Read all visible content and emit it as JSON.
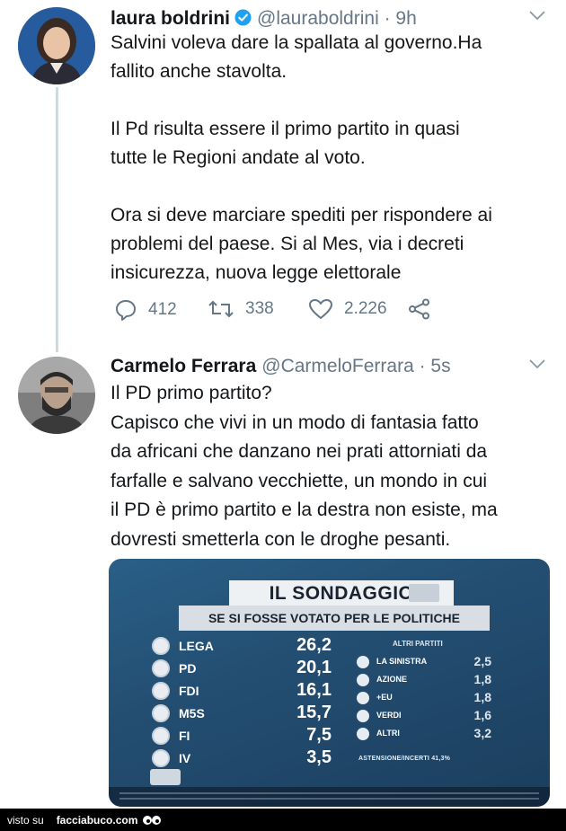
{
  "tweet1": {
    "name": "laura boldrini",
    "handle": "@lauraboldrini · 9h",
    "lines": [
      "Salvini voleva dare la spallata al governo.Ha",
      "fallito anche stavolta.",
      "",
      "Il Pd risulta essere il primo partito in quasi",
      "tutte le Regioni andate al voto.",
      "",
      "Ora si deve marciare spediti per rispondere ai",
      "problemi del paese. Si al Mes, via i decreti",
      "insicurezza, nuova legge elettorale"
    ],
    "replies": "412",
    "retweets": "338",
    "likes": "2.226"
  },
  "tweet2": {
    "name": "Carmelo Ferrara",
    "handle": "@CarmeloFerrara · 5s",
    "lines": [
      "Il PD primo partito?",
      "Capisco che vivi in un modo di fantasia fatto",
      "da africani che danzano nei prati attorniati da",
      "farfalle e salvano vecchiette, un mondo in cui",
      "il PD è primo partito e la destra non esiste, ma",
      "dovresti smetterla con le droghe pesanti."
    ]
  },
  "poll": {
    "title": "IL SONDAGGIO",
    "subtitle": "SE SI FOSSE VOTATO PER LE POLITICHE",
    "parties": [
      {
        "name": "LEGA",
        "value": "26,2"
      },
      {
        "name": "PD",
        "value": "20,1"
      },
      {
        "name": "FDI",
        "value": "16,1"
      },
      {
        "name": "M5S",
        "value": "15,7"
      },
      {
        "name": "FI",
        "value": "7,5"
      },
      {
        "name": "IV",
        "value": "3,5"
      }
    ],
    "others_title": "ALTRI PARTITI",
    "others": [
      {
        "name": "LA SINISTRA",
        "value": "2,5"
      },
      {
        "name": "AZIONE",
        "value": "1,8"
      },
      {
        "name": "+EU",
        "value": "1,8"
      },
      {
        "name": "VERDI",
        "value": "1,6"
      },
      {
        "name": "ALTRI",
        "value": "3,2"
      }
    ],
    "abstention": "ASTENSIONE/INCERTI 41,3%"
  },
  "footer": {
    "label": "visto su",
    "site": "facciabuco.com"
  },
  "colors": {
    "text": "#14171a",
    "secondary": "#657786",
    "verified": "#1da1f2",
    "thread_line": "#cfd9de"
  }
}
